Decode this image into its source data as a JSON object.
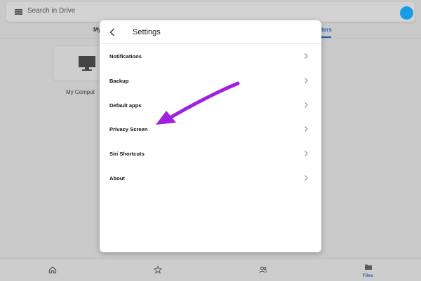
{
  "search": {
    "placeholder": "Search in Drive"
  },
  "tabs": {
    "left_label": "My",
    "right_label": "ters"
  },
  "computer": {
    "label": "My Comput"
  },
  "modal": {
    "title": "Settings",
    "items": [
      {
        "label": "Notifications"
      },
      {
        "label": "Backup"
      },
      {
        "label": "Default apps"
      },
      {
        "label": "Privacy Screen"
      },
      {
        "label": "Siri Shortcuts"
      },
      {
        "label": "About"
      }
    ]
  },
  "bottom_nav": {
    "files_label": "Files"
  },
  "colors": {
    "accent": "#1a5fb4",
    "avatar": "#1a9be6",
    "annotation_arrow": "#a020e0",
    "backdrop": "#c9c9c9"
  },
  "icons": {
    "menu": "menu-icon",
    "back": "back-arrow-icon",
    "chevron": "chevron-right-icon",
    "monitor": "computer-icon",
    "home": "home-icon",
    "star": "star-icon",
    "shared": "shared-icon",
    "files": "folder-icon"
  }
}
